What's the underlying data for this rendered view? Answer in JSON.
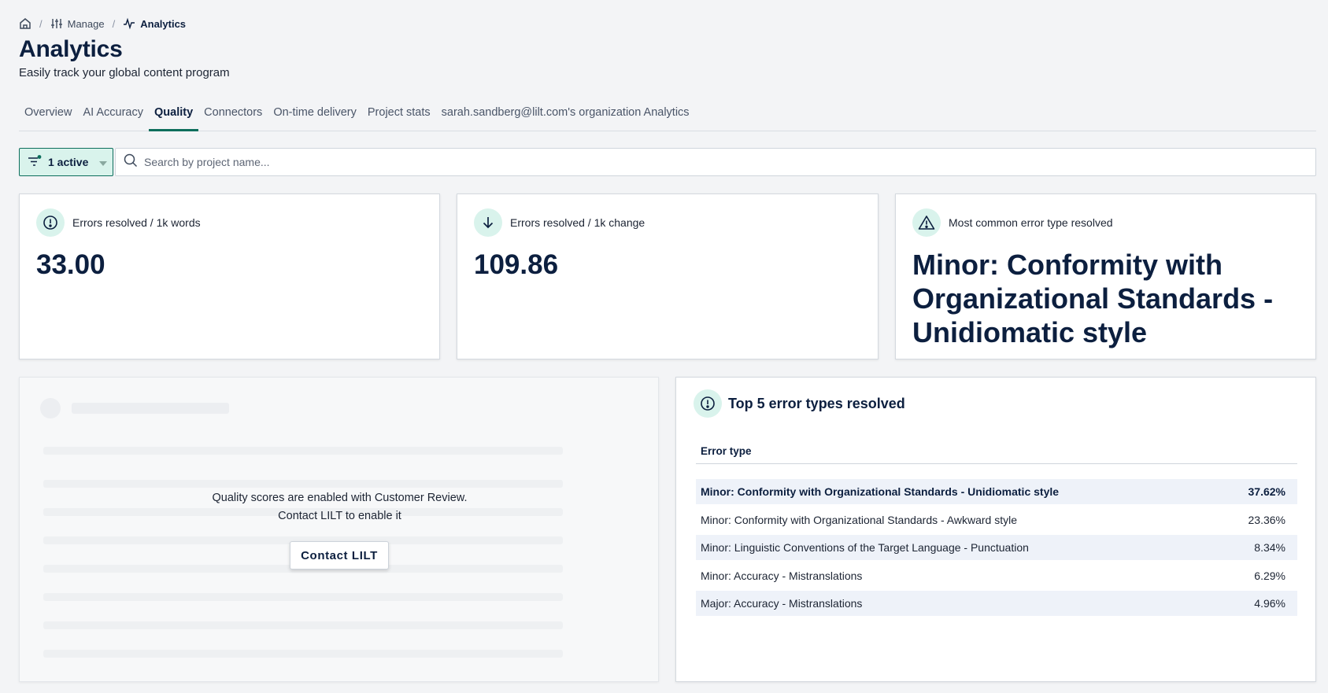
{
  "breadcrumb": {
    "manage": "Manage",
    "current": "Analytics"
  },
  "header": {
    "title": "Analytics",
    "subtitle": "Easily track your global content program"
  },
  "tabs": [
    {
      "label": "Overview",
      "active": false
    },
    {
      "label": "AI Accuracy",
      "active": false
    },
    {
      "label": "Quality",
      "active": true
    },
    {
      "label": "Connectors",
      "active": false
    },
    {
      "label": "On-time delivery",
      "active": false
    },
    {
      "label": "Project stats",
      "active": false
    },
    {
      "label": "sarah.sandberg@lilt.com's organization Analytics",
      "active": false
    }
  ],
  "filters": {
    "active_label": "1 active"
  },
  "search": {
    "placeholder": "Search by project name...",
    "value": ""
  },
  "stats": [
    {
      "icon": "alert-circle-icon",
      "label": "Errors resolved / 1k words",
      "value": "33.00"
    },
    {
      "icon": "arrow-down-icon",
      "label": "Errors resolved / 1k change",
      "value": "109.86"
    },
    {
      "icon": "warning-triangle-icon",
      "label": "Most common error type resolved",
      "value": "Minor: Conformity with Organizational Standards - Unidiomatic style"
    }
  ],
  "quality_scores": {
    "message_line1": "Quality scores are enabled with Customer Review.",
    "message_line2": "Contact LILT to enable it",
    "button_label": "Contact LILT"
  },
  "top_errors": {
    "title": "Top 5 error types resolved",
    "column_header": "Error type",
    "rows": [
      {
        "type": "Minor: Conformity with Organizational Standards - Unidiomatic style",
        "percent": "37.62%"
      },
      {
        "type": "Minor: Conformity with Organizational Standards - Awkward style",
        "percent": "23.36%"
      },
      {
        "type": "Minor: Linguistic Conventions of the Target Language - Punctuation",
        "percent": "8.34%"
      },
      {
        "type": "Minor: Accuracy - Mistranslations",
        "percent": "6.29%"
      },
      {
        "type": "Major: Accuracy - Mistranslations",
        "percent": "4.96%"
      }
    ]
  },
  "colors": {
    "accent": "#0d6e5c",
    "accent_light": "#d9f3ec",
    "heading": "#0c1f3f",
    "row_stripe": "#eef2f9"
  }
}
